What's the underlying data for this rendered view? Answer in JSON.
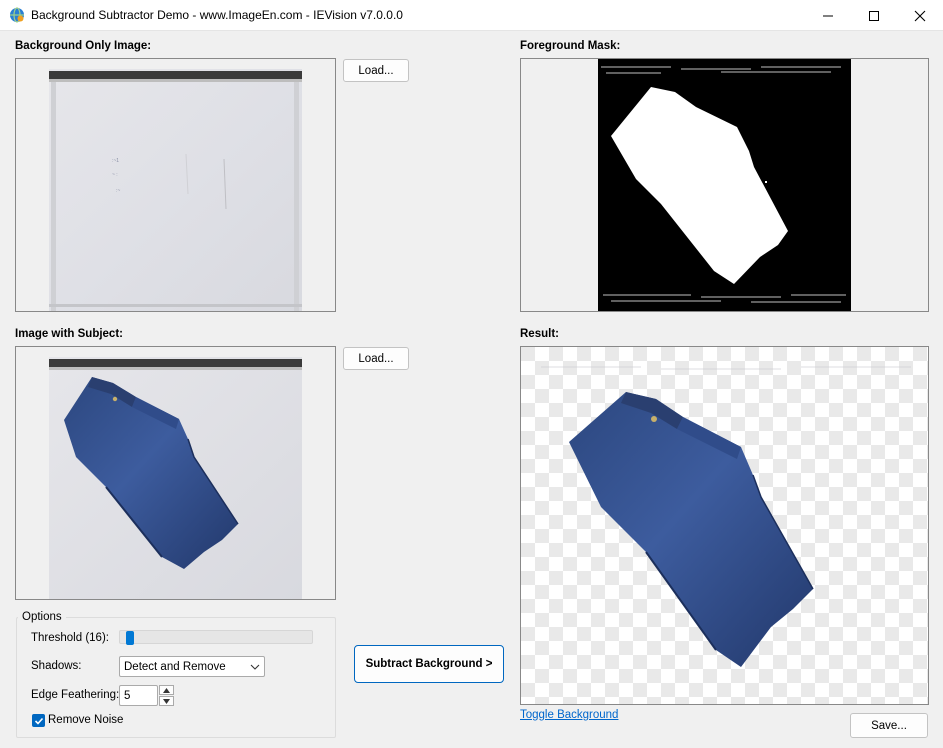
{
  "window": {
    "title": "Background Subtractor Demo - www.ImageEn.com - IEVision v7.0.0.0",
    "minimize_icon": "minimize-icon",
    "maximize_icon": "maximize-icon",
    "close_icon": "close-icon"
  },
  "panels": {
    "background_label": "Background Only Image:",
    "subject_label": "Image with Subject:",
    "mask_label": "Foreground Mask:",
    "result_label": "Result:"
  },
  "buttons": {
    "load_background": "Load...",
    "load_subject": "Load...",
    "subtract": "Subtract Background >",
    "save": "Save..."
  },
  "options": {
    "title": "Options",
    "threshold_label": "Threshold (16):",
    "threshold_value": 16,
    "threshold_fraction": 0.03,
    "shadows_label": "Shadows:",
    "shadows_value": "Detect and Remove",
    "edge_label": "Edge Feathering:",
    "edge_value": "5",
    "remove_noise_label": "Remove Noise",
    "remove_noise_checked": true
  },
  "links": {
    "toggle_background": "Toggle Background"
  },
  "colors": {
    "accent": "#0067c0",
    "link": "#0066cc",
    "jeans": "#2f4c8c"
  }
}
